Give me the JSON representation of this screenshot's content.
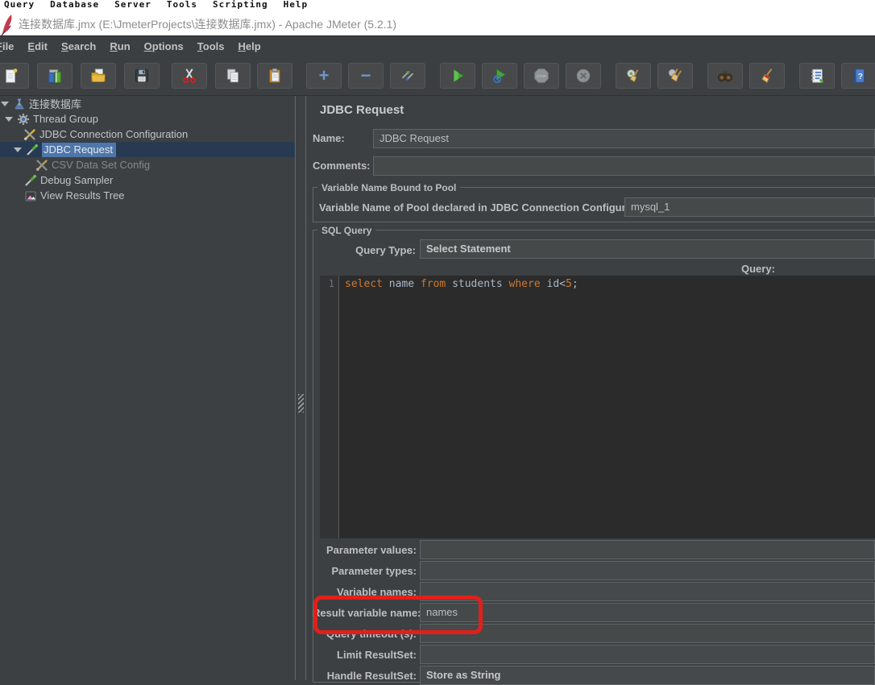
{
  "background_window": {
    "menu_items": [
      "Query",
      "Database",
      "Server",
      "Tools",
      "Scripting",
      "Help"
    ]
  },
  "title_bar": {
    "title": "连接数据库.jmx (E:\\JmeterProjects\\连接数据库.jmx) - Apache JMeter (5.2.1)"
  },
  "menu_bar": {
    "items": [
      {
        "label": "File"
      },
      {
        "label": "Edit"
      },
      {
        "label": "Search"
      },
      {
        "label": "Run"
      },
      {
        "label": "Options"
      },
      {
        "label": "Tools"
      },
      {
        "label": "Help"
      }
    ]
  },
  "toolbar": {
    "buttons": [
      {
        "name": "new-file"
      },
      {
        "name": "templates"
      },
      {
        "name": "open-file"
      },
      {
        "name": "save"
      },
      {
        "name": "cut"
      },
      {
        "name": "copy"
      },
      {
        "name": "paste"
      },
      {
        "name": "add",
        "glyph": "+"
      },
      {
        "name": "remove",
        "glyph": "−"
      },
      {
        "name": "toggle"
      },
      {
        "name": "start"
      },
      {
        "name": "start-no-pauses"
      },
      {
        "name": "stop",
        "disabled": true,
        "glyph_text": "STOP"
      },
      {
        "name": "shutdown",
        "disabled": true
      },
      {
        "name": "clear"
      },
      {
        "name": "clear-all"
      },
      {
        "name": "search"
      },
      {
        "name": "clear-search"
      },
      {
        "name": "function-helper"
      },
      {
        "name": "help",
        "glyph_text": "?"
      }
    ]
  },
  "tree": {
    "selected": "JDBC Request",
    "items": [
      {
        "label": "连接数据库",
        "icon": "test-plan-flask-icon"
      },
      {
        "label": "Thread Group",
        "icon": "thread-group-gear-icon"
      },
      {
        "label": "JDBC Connection Configuration",
        "icon": "config-tools-icon"
      },
      {
        "label": "JDBC Request",
        "icon": "sampler-dropper-icon",
        "selected": true
      },
      {
        "label": "CSV Data Set Config",
        "icon": "config-tools-icon",
        "disabled": true
      },
      {
        "label": "Debug Sampler",
        "icon": "sampler-dropper-icon"
      },
      {
        "label": "View Results Tree",
        "icon": "results-chart-icon"
      }
    ]
  },
  "main": {
    "title": "JDBC Request",
    "name_label": "Name:",
    "name_value": "JDBC Request",
    "comments_label": "Comments:",
    "comments_value": "",
    "pool_group": {
      "title": "Variable Name Bound to Pool",
      "label": "Variable Name of Pool declared in JDBC Connection Configuration:",
      "value": "mysql_1"
    },
    "sql_group": {
      "title": "SQL Query",
      "query_type_label": "Query Type:",
      "query_type_value": "Select Statement",
      "query_label": "Query:",
      "editor": {
        "line_number": "1",
        "sql": "select name from students where id<5;",
        "tokens": [
          {
            "text": "select ",
            "type": "keyword"
          },
          {
            "text": "name ",
            "type": "identifier"
          },
          {
            "text": "from ",
            "type": "keyword"
          },
          {
            "text": "students ",
            "type": "identifier"
          },
          {
            "text": "where ",
            "type": "keyword"
          },
          {
            "text": "id<",
            "type": "identifier"
          },
          {
            "text": "5",
            "type": "number"
          },
          {
            "text": ";",
            "type": "identifier"
          }
        ]
      },
      "rows": [
        {
          "label": "Parameter values:",
          "value": ""
        },
        {
          "label": "Parameter types:",
          "value": ""
        },
        {
          "label": "Variable names:",
          "value": ""
        },
        {
          "label": "Result variable name:",
          "value": "names",
          "highlighted": true
        },
        {
          "label": "Query timeout (s):",
          "value": ""
        },
        {
          "label": "Limit ResultSet:",
          "value": ""
        },
        {
          "label": "Handle ResultSet:",
          "value": "Store as String"
        }
      ]
    }
  },
  "colors": {
    "dark_bg": "#3c4043",
    "bar_bg": "#3c3f41",
    "field_bg": "#45494a",
    "selection_label_blue": "#4f76a9",
    "selection_row_blue": "#283a52",
    "sql_keyword_orange": "#cc7832",
    "sql_identifier": "#a9b7c6",
    "annotation_red": "#df201b"
  }
}
